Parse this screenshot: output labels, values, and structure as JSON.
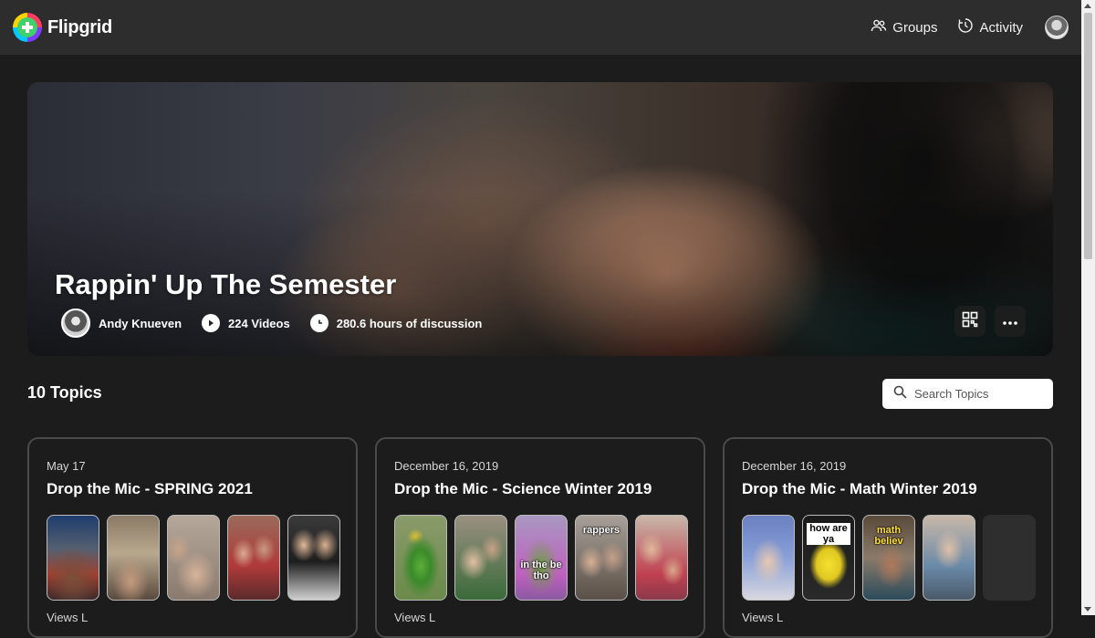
{
  "header": {
    "logo_text": "Flipgrid",
    "nav": [
      {
        "label": "Groups",
        "icon": "groups-icon"
      },
      {
        "label": "Activity",
        "icon": "activity-icon"
      }
    ]
  },
  "hero": {
    "title": "Rappin' Up The Semester",
    "owner": "Andy Knueven",
    "videos": "224 Videos",
    "discussion": "280.6 hours of discussion",
    "actions": [
      "qr-code-icon",
      "more-icon"
    ]
  },
  "topics": {
    "count_label": "10 Topics",
    "search_placeholder": "Search Topics"
  },
  "cards": [
    {
      "date": "May 17",
      "title": "Drop the Mic - SPRING 2021",
      "footer": "Views L"
    },
    {
      "date": "December 16, 2019",
      "title": "Drop the Mic - Science Winter 2019",
      "footer": "Views L",
      "captions": [
        "rappers",
        "in the be tho"
      ]
    },
    {
      "date": "December 16, 2019",
      "title": "Drop the Mic - Math Winter 2019",
      "footer": "Views L",
      "captions": [
        "how are ya",
        "math believ"
      ]
    }
  ],
  "colors": {
    "background": "#1c1c1c",
    "topbar": "#2d2d2d",
    "card_border": "#4a4a4a",
    "logo_green": "#3fd26b"
  }
}
